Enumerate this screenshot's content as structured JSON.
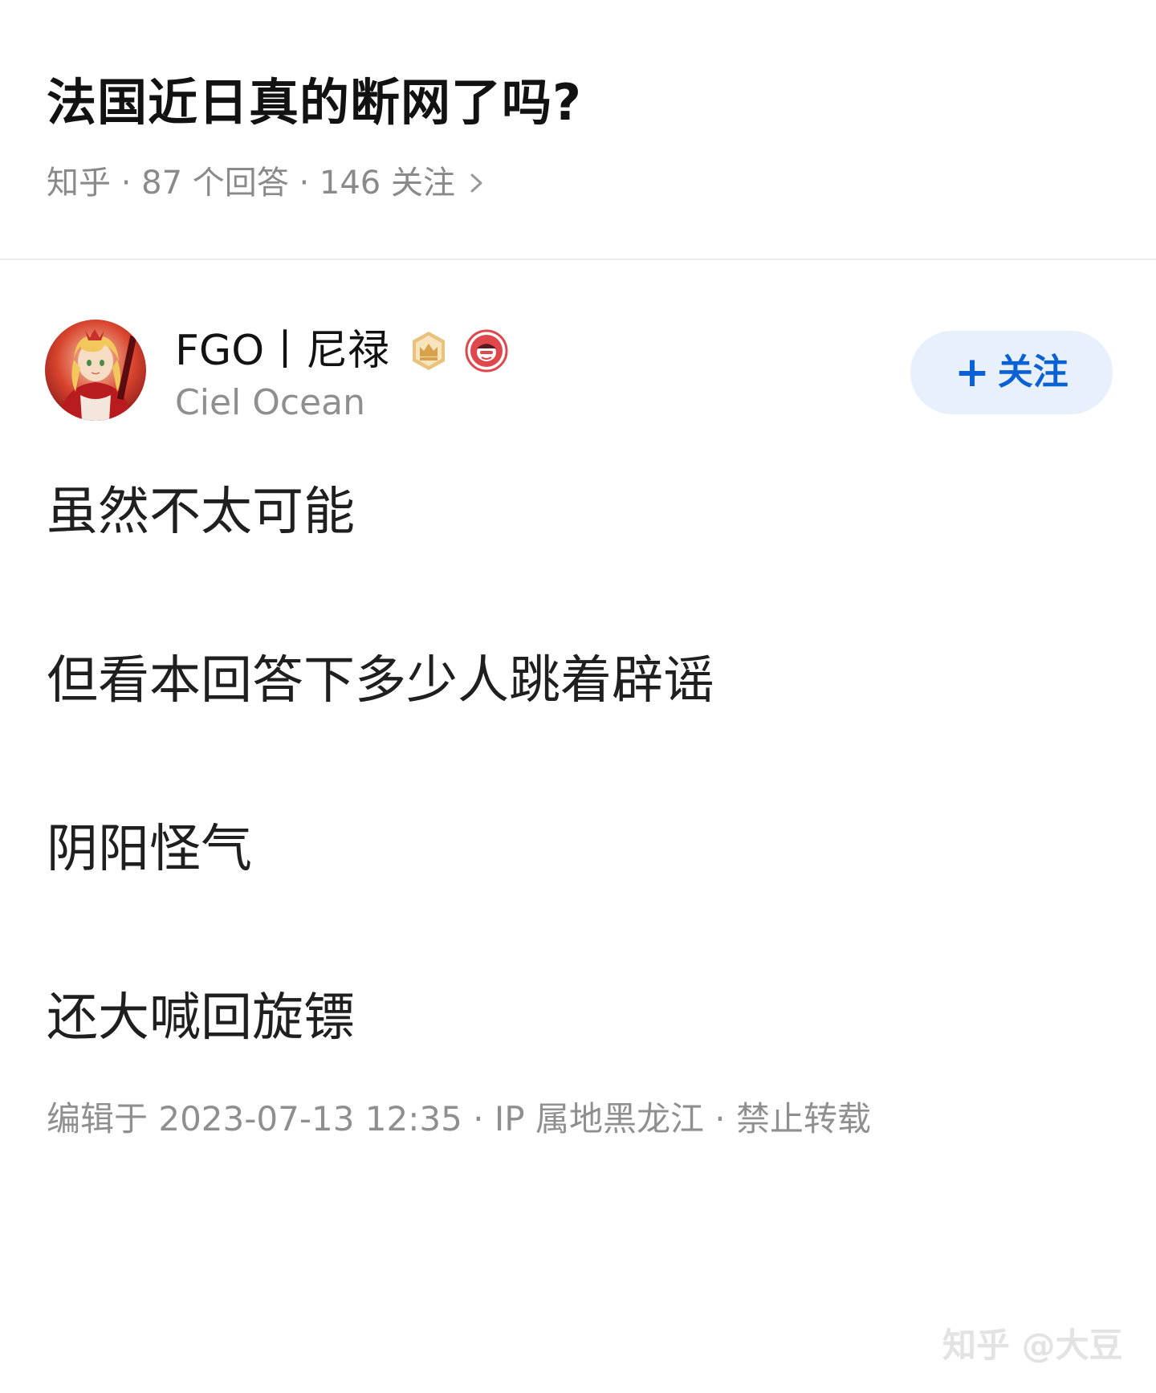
{
  "question": {
    "title": "法国近日真的断网了吗?",
    "meta": "知乎 · 87 个回答 · 146 关注"
  },
  "author": {
    "name": "FGO丨尼禄",
    "headline": "Ciel Ocean"
  },
  "follow_button": {
    "label": "关注"
  },
  "answer": {
    "paragraphs": [
      "虽然不太可能",
      "但看本回答下多少人跳着辟谣",
      "阴阳怪气",
      "还大喊回旋镖"
    ],
    "footer": "编辑于 2023-07-13 12:35 · IP 属地黑龙江 · 禁止转载"
  },
  "watermark": "知乎 @大豆",
  "colors": {
    "accent": "#0a61d4",
    "follow_bg": "#e8f1fb",
    "muted_text": "#8f8f8f"
  },
  "icons": {
    "meta_chevron": "chevron-right-icon",
    "badge_1": "gold-crown-badge-icon",
    "badge_2": "red-character-badge-icon"
  }
}
